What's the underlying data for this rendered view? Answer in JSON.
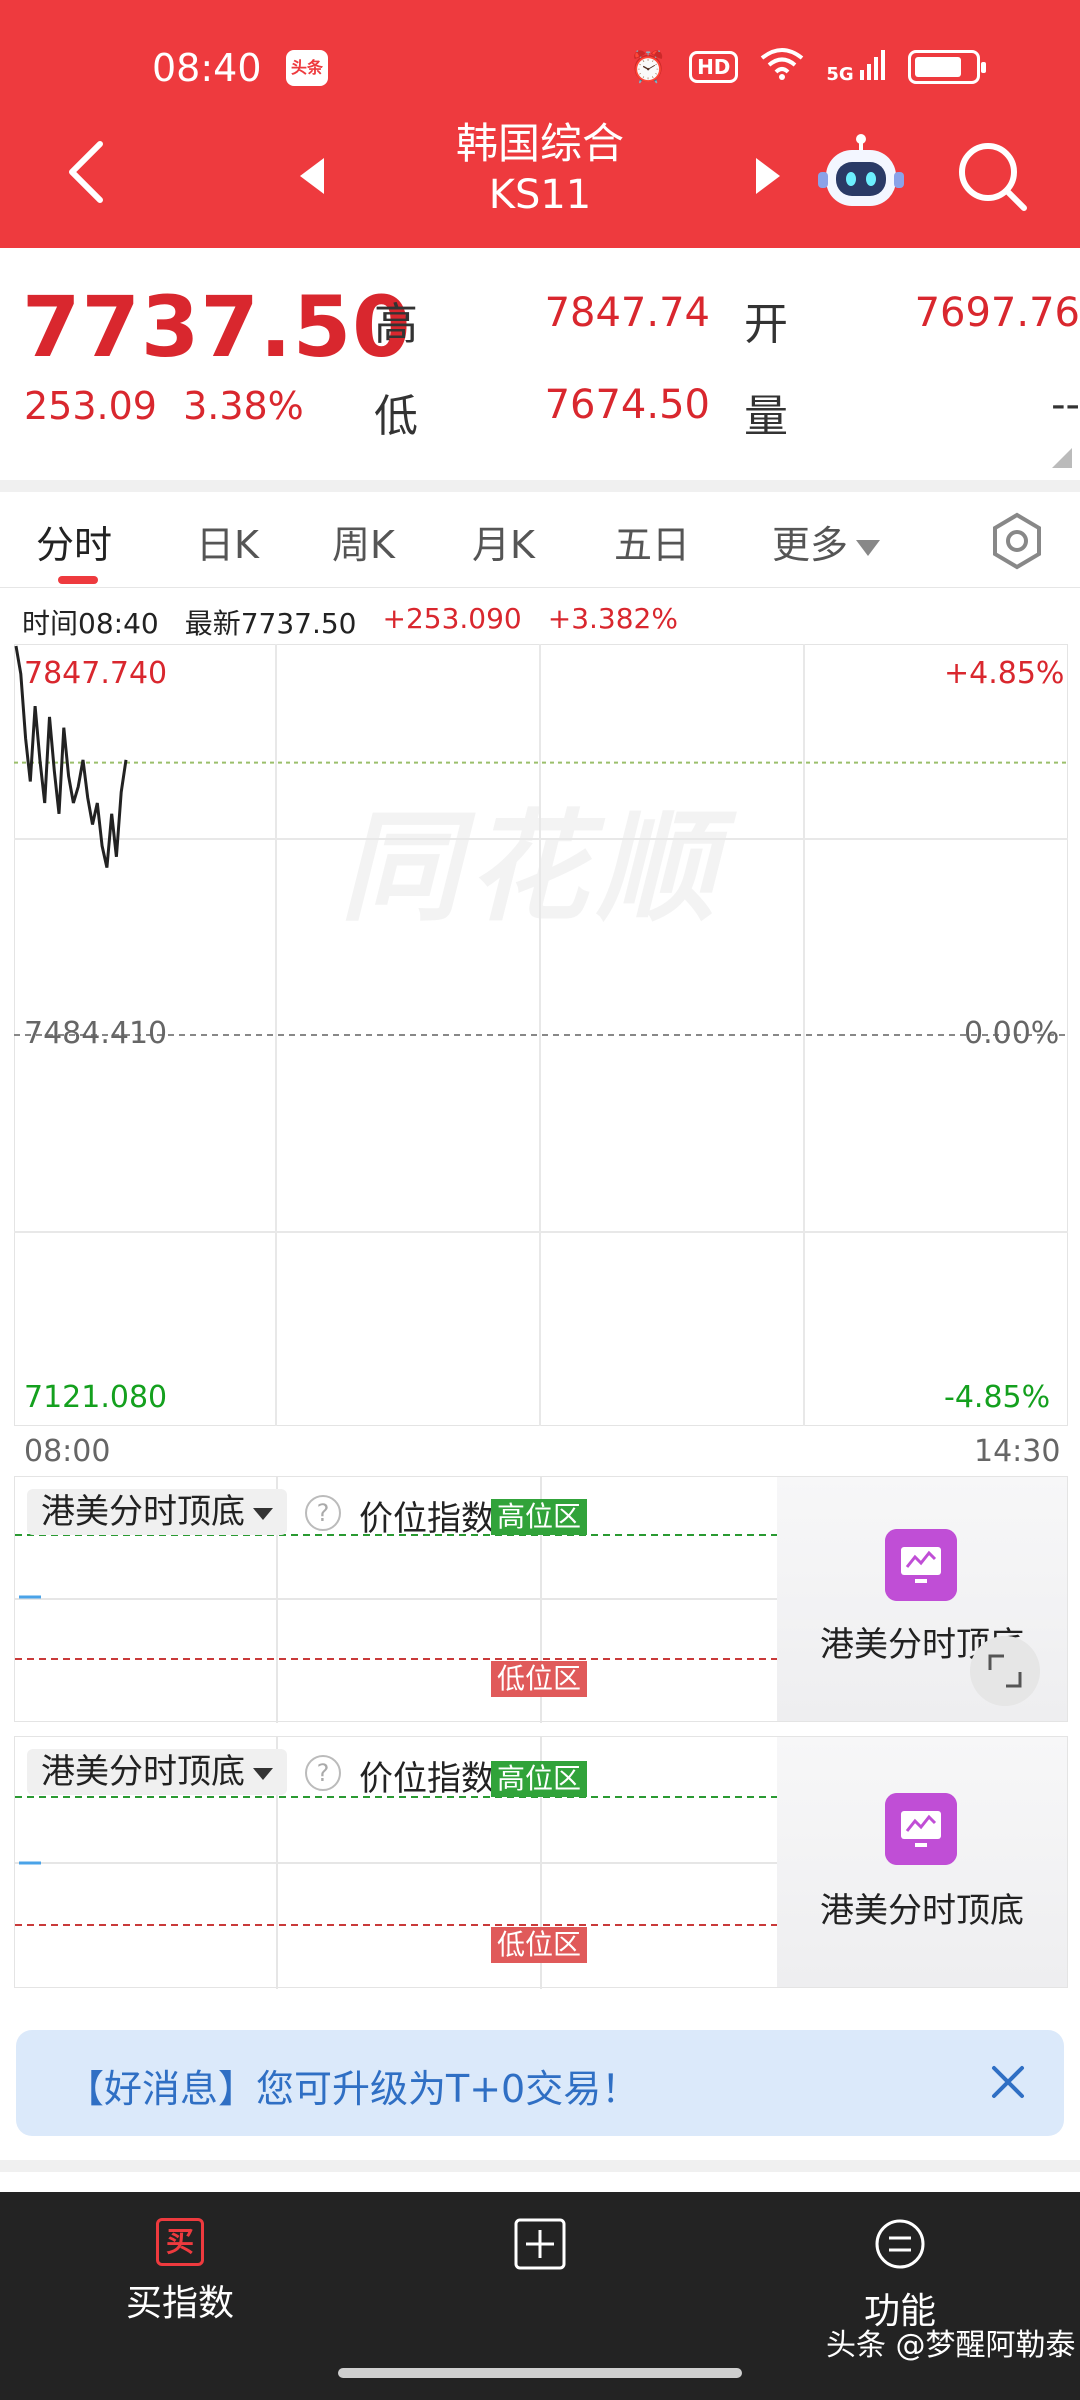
{
  "status_bar": {
    "time": "08:40",
    "badge": "头条",
    "hd": "HD",
    "network": "5G"
  },
  "header": {
    "title": "韩国综合",
    "code": "KS11"
  },
  "quote": {
    "price": "7737.50",
    "change": "253.09",
    "change_pct": "3.38%",
    "high_label": "高",
    "high": "7847.74",
    "open_label": "开",
    "open": "7697.76",
    "low_label": "低",
    "low": "7674.50",
    "volume_label": "量",
    "volume": "--"
  },
  "tabs": [
    {
      "label": "分时",
      "active": true
    },
    {
      "label": "日K"
    },
    {
      "label": "周K"
    },
    {
      "label": "月K"
    },
    {
      "label": "五日"
    },
    {
      "label": "更多"
    }
  ],
  "chart_info": {
    "time": "时间08:40",
    "latest": "最新7737.50",
    "change": "+253.090",
    "change_pct": "+3.382%"
  },
  "chart_data": {
    "type": "line",
    "y_top": "7847.740",
    "y_mid": "7484.410",
    "y_bottom": "7121.080",
    "pct_top": "+4.85%",
    "pct_mid": "0.00%",
    "pct_bottom": "-4.85%",
    "x_start": "08:00",
    "x_end": "14:30",
    "ylim": [
      7121.08,
      7847.74
    ],
    "reference": 7484.41,
    "current": 7737.5,
    "values": [
      7847,
      7820,
      7760,
      7720,
      7790,
      7740,
      7700,
      7780,
      7730,
      7690,
      7770,
      7725,
      7700,
      7715,
      7740,
      7705,
      7680,
      7700,
      7660,
      7640,
      7690,
      7650,
      7710,
      7740
    ]
  },
  "watermark": "同花顺",
  "indicators": [
    {
      "selector": "港美分时顶底",
      "help": "?",
      "name": "价位指数",
      "high_zone": "高位区",
      "low_zone": "低位区",
      "promo": "港美分时顶底"
    },
    {
      "selector": "港美分时顶底",
      "help": "?",
      "name": "价位指数",
      "high_zone": "高位区",
      "low_zone": "低位区",
      "promo": "港美分时顶底"
    }
  ],
  "banner": {
    "text": "【好消息】您可升级为T+0交易！"
  },
  "bottom_bar": {
    "buy_icon": "买",
    "buy_label": "买指数",
    "func_label": "功能"
  },
  "footer_watermark": "头条 @梦醒阿勒泰",
  "colors": {
    "header_red": "#ee3a3e",
    "up_red": "#d9272e",
    "down_green": "#14a01e"
  }
}
